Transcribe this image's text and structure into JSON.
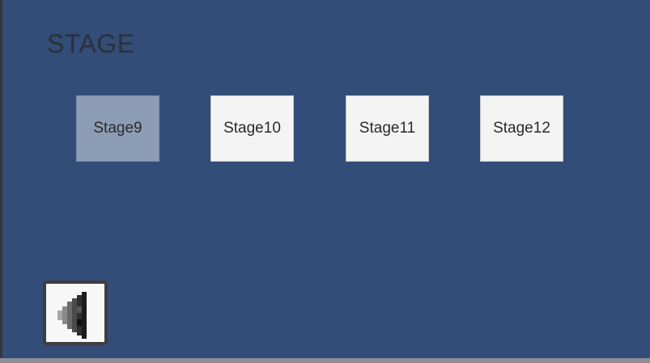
{
  "screen": {
    "title": "STAGE"
  },
  "stages": [
    {
      "label": "Stage9",
      "selected": true
    },
    {
      "label": "Stage10",
      "selected": false
    },
    {
      "label": "Stage11",
      "selected": false
    },
    {
      "label": "Stage12",
      "selected": false
    }
  ],
  "back_button": {
    "icon": "back-arrow-icon"
  },
  "colors": {
    "background": "#314d78",
    "button": "#f4f4f4",
    "button_selected": "#8c9db6",
    "title_text": "#2d3038"
  }
}
